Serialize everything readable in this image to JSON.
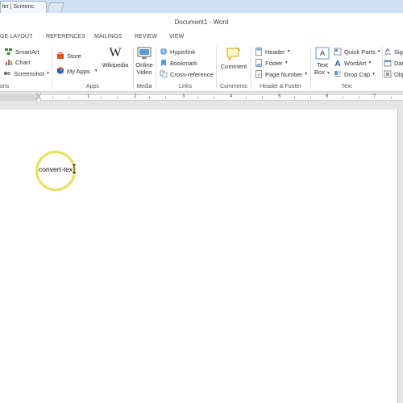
{
  "browser": {
    "tab_title": "ler | Screenc"
  },
  "window": {
    "title": "Document1 - Word"
  },
  "ribbon_tabs": [
    "GE LAYOUT",
    "REFERENCES",
    "MAILINGS",
    "REVIEW",
    "VIEW"
  ],
  "groups": {
    "illustrations": {
      "label": "ons",
      "smartart": "SmartArt",
      "chart": "Chart",
      "screenshot": "Screenshot"
    },
    "apps": {
      "label": "Apps",
      "store": "Store",
      "my_apps": "My Apps",
      "wikipedia": "Wikipedia"
    },
    "media": {
      "label": "Media",
      "online_video_line1": "Online",
      "online_video_line2": "Video"
    },
    "links": {
      "label": "Links",
      "hyperlink": "Hyperlink",
      "bookmark": "Bookmark",
      "cross_reference": "Cross-reference"
    },
    "comments": {
      "label": "Comments",
      "comment": "Comment"
    },
    "header_footer": {
      "label": "Header & Footer",
      "header": "Header",
      "footer": "Footer",
      "page_number": "Page Number"
    },
    "text": {
      "label": "Text",
      "text_box_line1": "Text",
      "text_box_line2": "Box",
      "quick_parts": "Quick Parts",
      "wordart": "WordArt",
      "drop_cap": "Drop Cap",
      "sign": "Sign",
      "date": "Date",
      "object": "Obj"
    }
  },
  "ruler": {
    "numbers": [
      "1",
      "2",
      "3",
      "4",
      "5",
      "6",
      "7"
    ]
  },
  "document": {
    "text": "convert-tex"
  },
  "colors": {
    "accent": "#2b579a",
    "highlight": "#e6e25a",
    "store_red": "#e74c1c",
    "page_bg": "#ffffff",
    "canvas_bg": "#e6e6e6"
  }
}
